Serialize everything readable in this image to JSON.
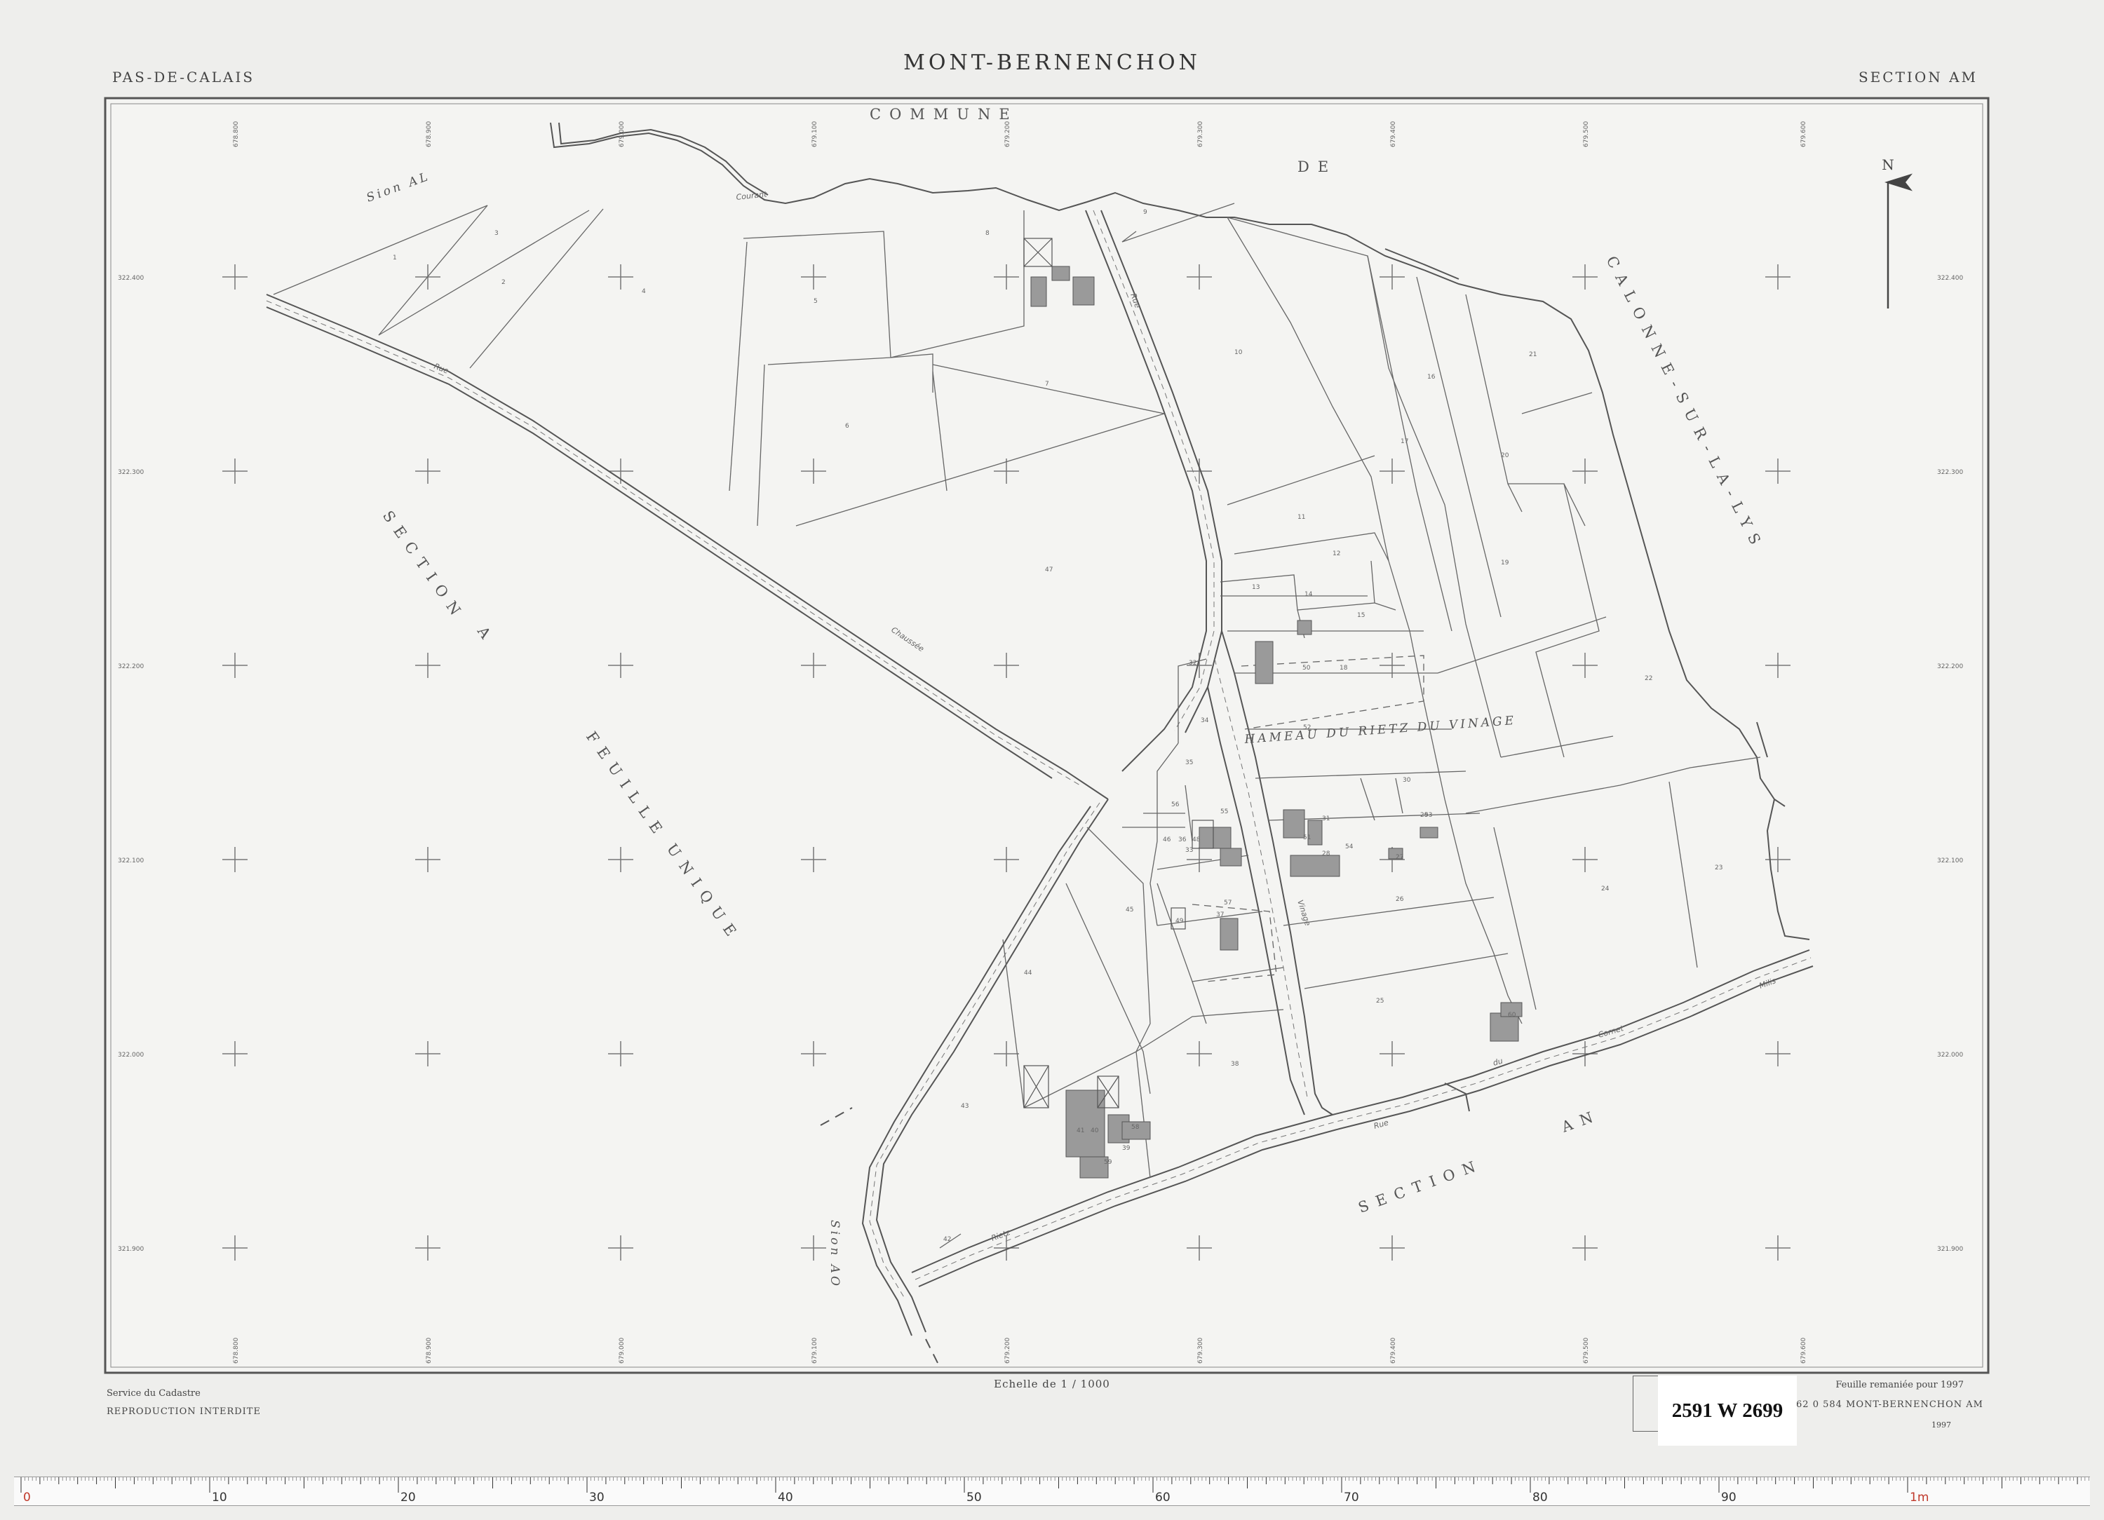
{
  "sheet": {
    "department": "PAS-DE-CALAIS",
    "title": "MONT-BERNENCHON",
    "section": "SECTION   AM",
    "service": "Service du Cadastre",
    "reproduction": "REPRODUCTION INTERDITE",
    "scale": "Echelle de 1 / 1000",
    "remaniee": "Feuille remaniée pour 1997",
    "reference": "62 0 584 MONT-BERNENCHON AM",
    "year": "1997",
    "archive_stamp": "2591 W 2699"
  },
  "map_labels": {
    "commune": "COMMUNE",
    "de": "DE",
    "calonne": "CALONNE-SUR-LA-LYS",
    "section_a": "SECTION",
    "a": "A",
    "feuille": "FEUILLE",
    "unique": "UNIQUE",
    "section_an": "SECTION",
    "an": "AN",
    "hameau": "HAMEAU DU RIETZ DU VINAGE",
    "sion_al": "Sion AL",
    "sion_ao": "Sion AO",
    "north": "N"
  },
  "road_labels": {
    "rue_top": "Rue",
    "chaussee": "Chaussée",
    "courant": "Courant",
    "rue_vertical": "Rue",
    "rue_lower": "Rue",
    "rue_du": "du",
    "cornet": "Cornet",
    "milis": "Milis",
    "rietz": "Rietz",
    "vinage": "Vinage"
  },
  "grid": {
    "top_ticks": [
      "678.800",
      "678.900",
      "679.000",
      "679.100",
      "679.200",
      "679.300",
      "679.400",
      "679.500",
      "679.600"
    ],
    "bottom_ticks": [
      "678.800",
      "678.900",
      "679.000",
      "679.100",
      "679.200",
      "679.300",
      "679.400",
      "679.500",
      "679.600"
    ],
    "left_ticks": [
      "322.400",
      "322.300",
      "322.200",
      "322.100",
      "322.000",
      "321.900"
    ],
    "right_ticks": [
      "322.400",
      "322.300",
      "322.200",
      "322.100",
      "322.000",
      "321.900"
    ]
  },
  "parcels": [
    "1",
    "2",
    "3",
    "4",
    "5",
    "6",
    "7",
    "8",
    "9",
    "10",
    "11",
    "12",
    "13",
    "14",
    "15",
    "16",
    "17",
    "18",
    "19",
    "20",
    "21",
    "22",
    "23",
    "24",
    "25",
    "26",
    "27",
    "28",
    "29",
    "30",
    "31",
    "32",
    "33",
    "34",
    "35",
    "36",
    "37",
    "38",
    "39",
    "40",
    "41",
    "42",
    "43",
    "44",
    "45",
    "46",
    "47",
    "48",
    "49",
    "50",
    "51",
    "52",
    "53",
    "54",
    "55",
    "56",
    "57",
    "58",
    "59",
    "60"
  ],
  "ruler": {
    "major_labels": [
      "0",
      "10",
      "20",
      "30",
      "40",
      "50",
      "60",
      "70",
      "80",
      "90",
      "1m"
    ]
  },
  "colors": {
    "ink": "#555555",
    "ink_light": "#7a7a7a",
    "paper": "#f3f3f1",
    "background": "#eeeeec",
    "stamp_bg": "#ffffff",
    "ruler_red": "#c0392b"
  }
}
